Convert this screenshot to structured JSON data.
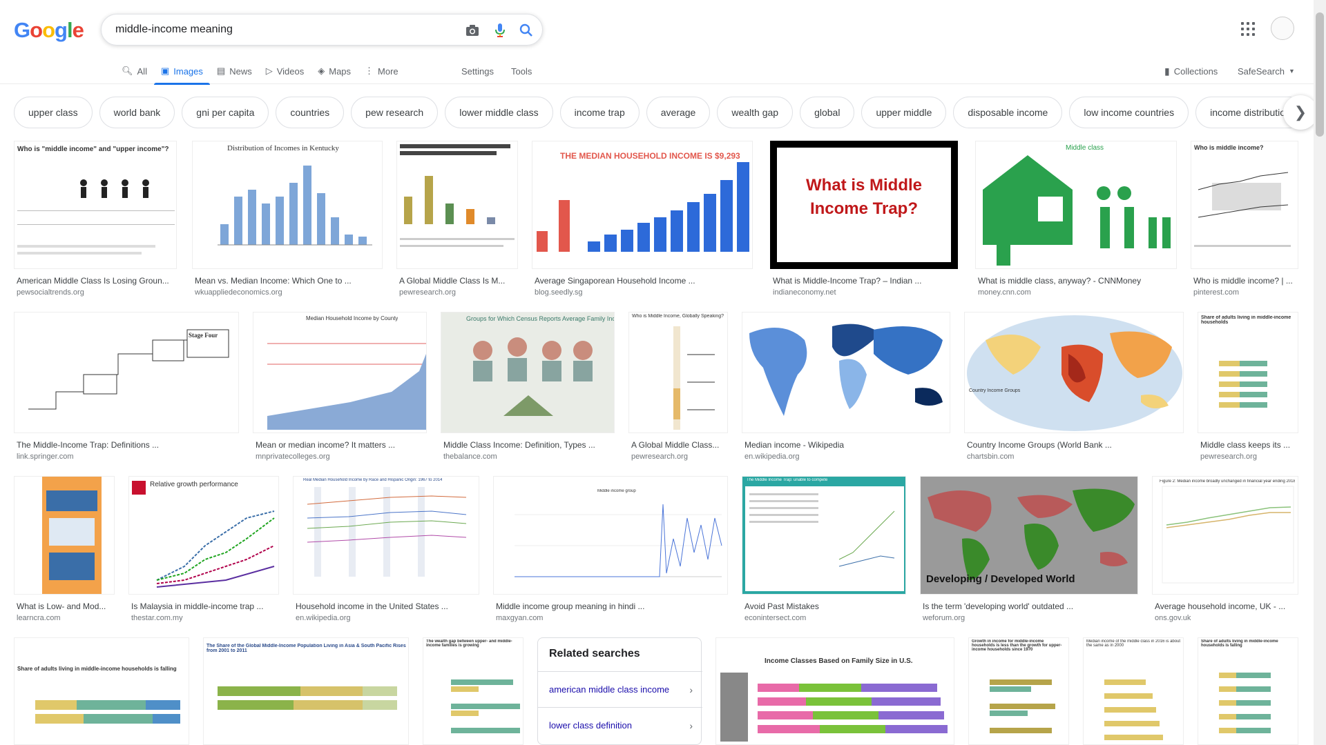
{
  "logo": "Google",
  "search": {
    "query": "middle-income meaning"
  },
  "tabs": [
    {
      "label": "All",
      "icon": "search-icon"
    },
    {
      "label": "Images",
      "icon": "image-icon",
      "active": true
    },
    {
      "label": "News",
      "icon": "news-icon"
    },
    {
      "label": "Videos",
      "icon": "video-icon"
    },
    {
      "label": "Maps",
      "icon": "map-icon"
    },
    {
      "label": "More",
      "icon": "more-vertical-icon"
    }
  ],
  "settings_label": "Settings",
  "tools_label": "Tools",
  "collections_label": "Collections",
  "safesearch_label": "SafeSearch",
  "chips": [
    "upper class",
    "world bank",
    "gni per capita",
    "countries",
    "pew research",
    "lower middle class",
    "income trap",
    "average",
    "wealth gap",
    "global",
    "upper middle",
    "disposable income",
    "low income countries",
    "income distribution"
  ],
  "results": [
    {
      "title": "American Middle Class Is Losing Groun...",
      "source": "pewsocialtrends.org",
      "thumb_text": "Who is \"middle income\" and \"upper income\"?"
    },
    {
      "title": "Mean vs. Median Income: Which One to ...",
      "source": "wkuappliedeconomics.org",
      "thumb_text": "Distribution of Incomes in Kentucky"
    },
    {
      "title": "A Global Middle Class Is M...",
      "source": "pewresearch.org",
      "thumb_text": "Poverty Plunges from 2001 to 2011 and the Global Middle-Income Population Increases"
    },
    {
      "title": "Average Singaporean Household Income ...",
      "source": "blog.seedly.sg",
      "thumb_text": "THE MEDIAN HOUSEHOLD INCOME IS $9,293"
    },
    {
      "title": "What is Middle-Income Trap? – Indian ...",
      "source": "indianeconomy.net",
      "thumb_text": "What is Middle Income Trap?"
    },
    {
      "title": "What is middle class, anyway? - CNNMoney",
      "source": "money.cnn.com",
      "thumb_text": "Middle class"
    },
    {
      "title": "Who is middle income? | ...",
      "source": "pinterest.com",
      "thumb_text": "Who is middle income?"
    },
    {
      "title": "The Middle-Income Trap: Definitions ...",
      "source": "link.springer.com",
      "thumb_text": "Stage Four"
    },
    {
      "title": "Mean or median income? It matters ...",
      "source": "mnprivatecolleges.org",
      "thumb_text": "Median Household Income by County"
    },
    {
      "title": "Middle Class Income: Definition, Types ...",
      "source": "thebalance.com",
      "thumb_text": "Groups for Which Census Reports Average Family Incomes"
    },
    {
      "title": "A Global Middle Class...",
      "source": "pewresearch.org",
      "thumb_text": "Who is Middle Income, Globally Speaking?"
    },
    {
      "title": "Median income - Wikipedia",
      "source": "en.wikipedia.org",
      "thumb_text": ""
    },
    {
      "title": "Country Income Groups (World Bank ...",
      "source": "chartsbin.com",
      "thumb_text": "Country Income Groups"
    },
    {
      "title": "Middle class keeps its ...",
      "source": "pewresearch.org",
      "thumb_text": "Share of adults living in middle-income households"
    },
    {
      "title": "What is Low- and Mod...",
      "source": "learncra.com",
      "thumb_text": ""
    },
    {
      "title": "Is Malaysia in middle-income trap ...",
      "source": "thestar.com.my",
      "thumb_text": "Relative growth performance"
    },
    {
      "title": "Household income in the United States ...",
      "source": "en.wikipedia.org",
      "thumb_text": "Real Median Household Income by Race and Hispanic Origin: 1967 to 2014"
    },
    {
      "title": "Middle income group meaning in hindi ...",
      "source": "maxgyan.com",
      "thumb_text": "Middle income group"
    },
    {
      "title": "Avoid Past Mistakes",
      "source": "econintersect.com",
      "thumb_text": "The Middle Income Trap: unable to compete"
    },
    {
      "title": "Is the term 'developing world' outdated ...",
      "source": "weforum.org",
      "thumb_text": "Developing / Developed World"
    },
    {
      "title": "Average household income, UK - ...",
      "source": "ons.gov.uk",
      "thumb_text": "Figure 2: Median income broadly unchanged in financial year ending 2018"
    },
    {
      "title": "",
      "source": "",
      "thumb_text": "Share of adults living in middle-income households is falling"
    },
    {
      "title": "",
      "source": "",
      "thumb_text": "The Share of the Global Middle-Income Population Living in Asia & South Pacific Rises from 2001 to 2011"
    },
    {
      "title": "",
      "source": "",
      "thumb_text": "The wealth gap between upper- and middle-income families is growing"
    },
    {
      "title": "",
      "source": "",
      "thumb_text": "Income Classes Based on Family Size in U.S."
    },
    {
      "title": "",
      "source": "",
      "thumb_text": "Growth in income for middle-income households is less than the growth for upper-income households since 1970"
    },
    {
      "title": "",
      "source": "",
      "thumb_text": "Median income of the middle class in 2016 is about the same as in 2000"
    },
    {
      "title": "",
      "source": "",
      "thumb_text": "Share of adults living in middle-income households is falling"
    }
  ],
  "related": {
    "heading": "Related searches",
    "items": [
      "american middle class income",
      "lower class definition"
    ]
  },
  "colors": {
    "accent": "#1a73e8",
    "link": "#1a0dab",
    "chip_border": "#dfe1e5"
  }
}
